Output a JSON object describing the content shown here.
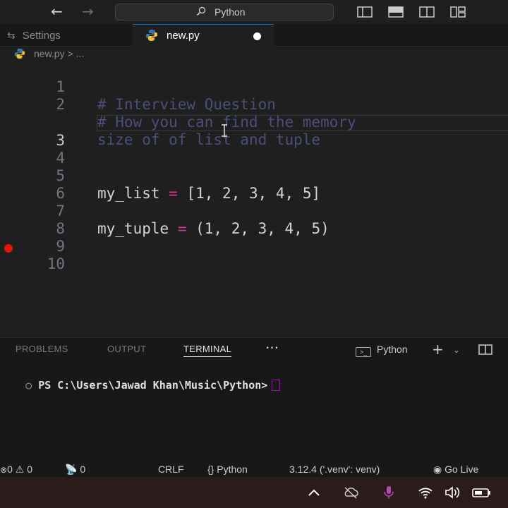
{
  "titlebar": {
    "search_text": "Python",
    "icons": [
      "back-arrow-icon",
      "forward-arrow-icon",
      "search-icon",
      "toggle-sidebar-icon",
      "toggle-panel-icon",
      "toggle-secondary-sidebar-icon",
      "customize-layout-icon"
    ]
  },
  "tabs": {
    "settings_label": "Settings",
    "active_label": "new.py"
  },
  "breadcrumb": {
    "file": "new.py",
    "sep": ">",
    "more": "..."
  },
  "editor": {
    "lines": [
      {
        "n": "1",
        "text": "# Interview Question"
      },
      {
        "n": "2",
        "text": "# How you can find the memory"
      },
      {
        "n": "",
        "text": "size of of list and tuple"
      },
      {
        "n": "3",
        "text": ""
      },
      {
        "n": "4",
        "text": ""
      },
      {
        "n": "5",
        "var": "my_list",
        "op": "=",
        "value": "[1, 2, 3, 4, 5]"
      },
      {
        "n": "6",
        "text": ""
      },
      {
        "n": "7",
        "var": "my_tuple",
        "op": "=",
        "value": "(1, 2, 3, 4, 5)"
      },
      {
        "n": "8",
        "text": ""
      },
      {
        "n": "9",
        "text": ""
      },
      {
        "n": "10",
        "text": ""
      }
    ],
    "active_line": "3",
    "breakpoint_line": "10"
  },
  "panel": {
    "tabs": [
      "PROBLEMS",
      "OUTPUT",
      "TERMINAL"
    ],
    "active_tab": "TERMINAL",
    "more": "···",
    "shell_label": "Python",
    "prompt": "PS C:\\Users\\Jawad Khan\\Music\\Python>"
  },
  "statusbar": {
    "errors": "0",
    "warnings": "0",
    "ports": "0",
    "eol": "CRLF",
    "language_brace": "{}",
    "language": "Python",
    "interpreter": "3.12.4 ('.venv': venv)",
    "go_live": "Go Live"
  },
  "colors": {
    "editor_bg": "#1f1f1f",
    "comment": "#4a4f7a",
    "operator": "#d4368f",
    "accent": "#0078d4",
    "breakpoint": "#e51400",
    "taskbar_bg": "#2b1b1b"
  }
}
